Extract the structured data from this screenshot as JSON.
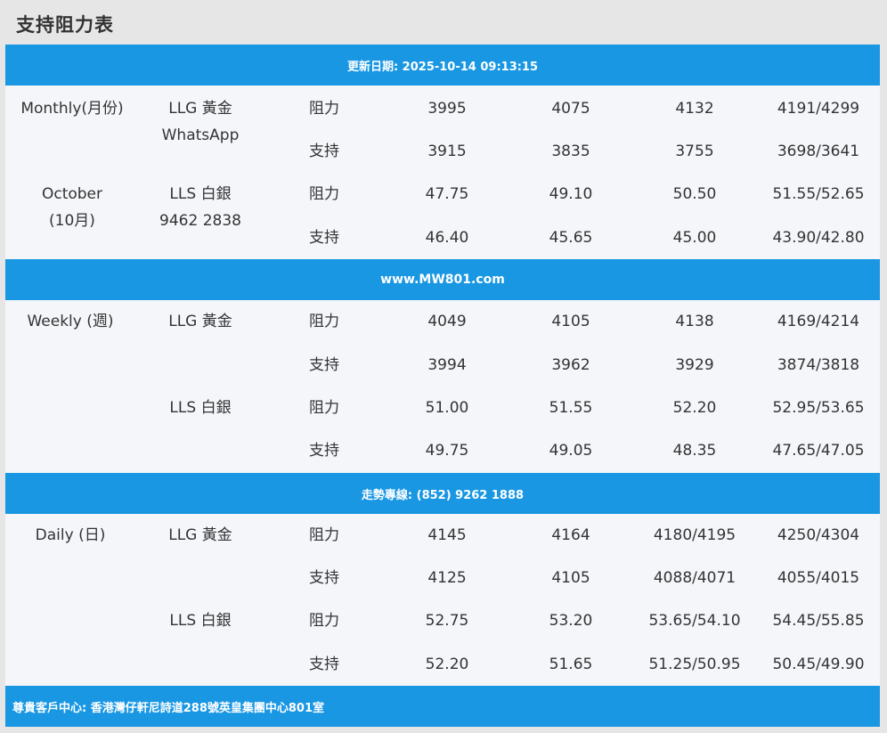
{
  "title": "支持阻力表",
  "bands": {
    "update": "更新日期: 2025-10-14 09:13:15",
    "website": "www.MW801.com",
    "hotline": "走勢專線: (852) 9262 1888",
    "address": "尊貴客戶中心: 香港灣仔軒尼詩道288號英皇集團中心801室"
  },
  "monthly": {
    "period": "Monthly(月份)",
    "llg": "LLG 黃金",
    "contact_label": "WhatsApp",
    "month": "October",
    "month_cn": "(10月)",
    "lls": "LLS 白銀",
    "contact_number": "9462 2838",
    "rows": [
      {
        "type": "阻力",
        "v": [
          "3995",
          "4075",
          "4132",
          "4191/4299"
        ]
      },
      {
        "type": "支持",
        "v": [
          "3915",
          "3835",
          "3755",
          "3698/3641"
        ]
      },
      {
        "type": "阻力",
        "v": [
          "47.75",
          "49.10",
          "50.50",
          "51.55/52.65"
        ]
      },
      {
        "type": "支持",
        "v": [
          "46.40",
          "45.65",
          "45.00",
          "43.90/42.80"
        ]
      }
    ]
  },
  "weekly": {
    "period": "Weekly (週)",
    "llg": "LLG 黃金",
    "lls": "LLS 白銀",
    "rows": [
      {
        "type": "阻力",
        "v": [
          "4049",
          "4105",
          "4138",
          "4169/4214"
        ]
      },
      {
        "type": "支持",
        "v": [
          "3994",
          "3962",
          "3929",
          "3874/3818"
        ]
      },
      {
        "type": "阻力",
        "v": [
          "51.00",
          "51.55",
          "52.20",
          "52.95/53.65"
        ]
      },
      {
        "type": "支持",
        "v": [
          "49.75",
          "49.05",
          "48.35",
          "47.65/47.05"
        ]
      }
    ]
  },
  "daily": {
    "period": "Daily (日)",
    "llg": "LLG 黃金",
    "lls": "LLS 白銀",
    "rows": [
      {
        "type": "阻力",
        "v": [
          "4145",
          "4164",
          "4180/4195",
          "4250/4304"
        ]
      },
      {
        "type": "支持",
        "v": [
          "4125",
          "4105",
          "4088/4071",
          "4055/4015"
        ]
      },
      {
        "type": "阻力",
        "v": [
          "52.75",
          "53.20",
          "53.65/54.10",
          "54.45/55.85"
        ]
      },
      {
        "type": "支持",
        "v": [
          "52.20",
          "51.65",
          "51.25/50.95",
          "50.45/49.90"
        ]
      }
    ]
  }
}
